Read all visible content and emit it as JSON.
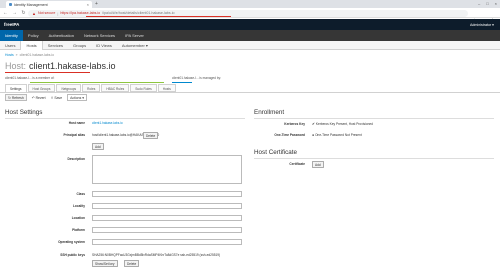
{
  "browser": {
    "tab_title": "Identity Management",
    "not_secure": "Not secure",
    "url_host": "https://ipa.hakase-labs.io",
    "url_path": "/ipa/ui/#/e/host/details/client01.hakase-labs.io"
  },
  "app": {
    "brand": "freeIPA",
    "user_menu": "Administrator ▾",
    "main_nav": [
      "Identity",
      "Policy",
      "Authentication",
      "Network Services",
      "IPA Server"
    ],
    "sub_nav": [
      "Users",
      "Hosts",
      "Services",
      "Groups",
      "ID Views",
      "Automember ▾"
    ]
  },
  "breadcrumb": {
    "parent": "Hosts",
    "separator": "»",
    "current": "client01.hakase-labs.io"
  },
  "page": {
    "kind": "Host:",
    "name": "client1.hakase-labs.io"
  },
  "membership": {
    "member_of": "client01.hakase-l... is a member of:",
    "managed_by": "client01.hakase-l... is managed by:"
  },
  "facet_tabs": [
    "Settings",
    "Host Groups",
    "Netgroups",
    "Roles",
    "HBAC Rules",
    "Sudo Rules",
    "Hosts"
  ],
  "actions": {
    "refresh": "Refresh",
    "revert": "Revert",
    "save": "Save",
    "actions": "Actions ▾"
  },
  "host_settings": {
    "heading": "Host Settings",
    "fields": {
      "host_name_label": "Host name",
      "host_name_value": "client1.hakase-labs.io",
      "principal_alias_label": "Principal alias",
      "principal_alias_value": "host/client1.hakase-labs.io@HAKASE-LABS.IO",
      "delete_label": "Delete",
      "add_label": "Add",
      "description_label": "Description",
      "class_label": "Class",
      "locality_label": "Locality",
      "location_label": "Location",
      "platform_label": "Platform",
      "os_label": "Operating system",
      "ssh_label": "SSH public keys",
      "ssh_value": "SHA256:N0BHQPFacU3GxjmBBd5lvRdaSMP4KhrTo8dGS7e ssh-ed25519 (ssh-ed25519)",
      "show_set_key": "Show/Set key",
      "ssh_delete": "Delete"
    }
  },
  "enrollment": {
    "heading": "Enrollment",
    "kerberos_key_label": "Kerberos Key",
    "kerberos_key_value": "Kerberos Key Present, Host Provisioned",
    "otp_label": "One-Time Password",
    "otp_value": "One-Time Password Not Present"
  },
  "host_certificate": {
    "heading": "Host Certificate",
    "certificate_label": "Certificate",
    "add_label": "Add"
  },
  "colors": {
    "header_bg": "#0d1c2b",
    "nav_bg": "#363636",
    "nav_active": "#0066aa",
    "link": "#0088ce",
    "annotation_red": "#d93025"
  }
}
